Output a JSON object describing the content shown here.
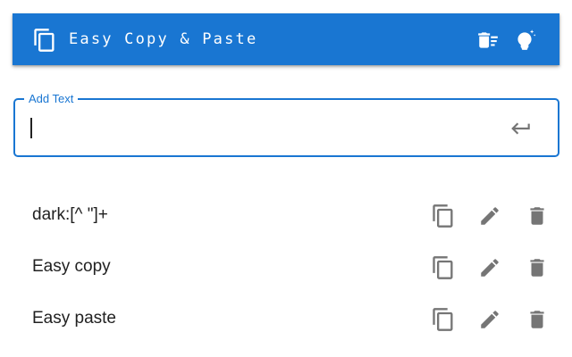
{
  "header": {
    "title": "Easy Copy & Paste",
    "app_icon": "copy-icon",
    "actions": [
      {
        "name": "clear-all-button",
        "icon": "delete-sweep-icon"
      },
      {
        "name": "theme-toggle-button",
        "icon": "lightbulb-sparkle-icon"
      }
    ]
  },
  "input": {
    "label": "Add Text",
    "value": "",
    "submit_icon": "keyboard-return-icon"
  },
  "items": [
    {
      "text": "dark:[^ \"]+"
    },
    {
      "text": "Easy copy"
    },
    {
      "text": "Easy paste"
    }
  ],
  "item_actions": [
    {
      "name": "copy-button",
      "icon": "copy-icon"
    },
    {
      "name": "edit-button",
      "icon": "pencil-icon"
    },
    {
      "name": "delete-button",
      "icon": "trash-icon"
    }
  ],
  "colors": {
    "primary": "#1976d2",
    "header_text": "#ffffff",
    "item_text": "#212121",
    "icon_gray": "#757575"
  }
}
